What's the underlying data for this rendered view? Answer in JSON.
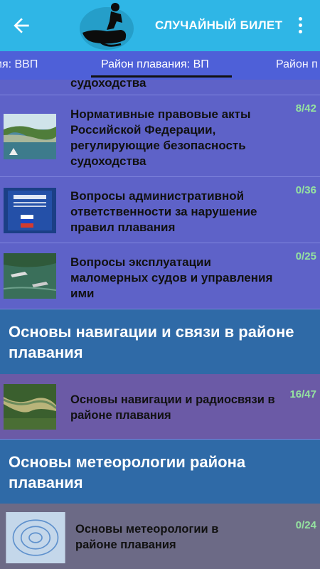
{
  "appbar": {
    "title": "СЛУЧАЙНЫЙ БИЛЕТ",
    "back_icon": "arrow-back-icon",
    "menu_icon": "more-vert-icon",
    "logo_icon": "jetski-rider-logo"
  },
  "tabs": [
    {
      "label": "ия: ВВП"
    },
    {
      "label": "Район плавания: ВП"
    },
    {
      "label": "Район п"
    }
  ],
  "partial_row": {
    "label": "судоходства"
  },
  "rows": [
    {
      "label": "Нормативные правовые акты Российской Федерации, регулирующие безопасность судоходства",
      "count": "8/42",
      "thumb_icon": "river-coast-photo"
    },
    {
      "label": "Вопросы административной ответственности за нарушение правил плавания",
      "count": "0/36",
      "thumb_icon": "codex-book-cover"
    },
    {
      "label": "Вопросы эксплуатации маломерных судов и управления ими",
      "count": "0/25",
      "thumb_icon": "boats-on-water-photo"
    }
  ],
  "sections": [
    {
      "title": "Основы навигации и связи в районе плавания",
      "row": {
        "label": "Основы навигации и радиосвязи в районе плавания",
        "count": "16/47",
        "thumb_icon": "river-map-photo"
      }
    },
    {
      "title": "Основы метеорологии района плавания",
      "row": {
        "label": "Основы метеорологии в районе плавания",
        "count": "0/24",
        "thumb_icon": "weather-map-image"
      }
    }
  ],
  "colors": {
    "appbar": "#2fb6e6",
    "tabs": "#4e60d8",
    "count": "#95e3a0",
    "section_header": "#2f6aa7"
  }
}
